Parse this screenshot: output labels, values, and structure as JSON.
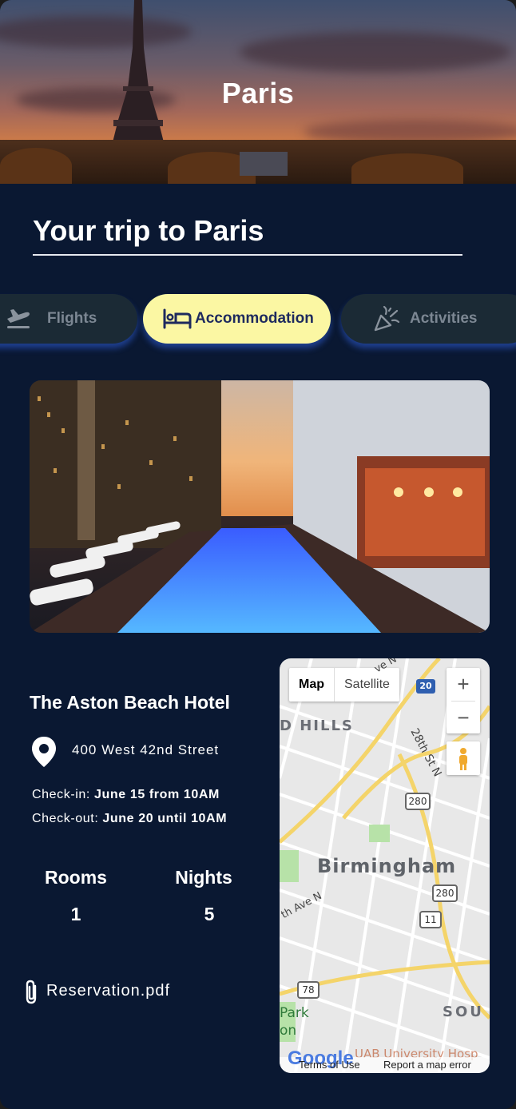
{
  "hero": {
    "city": "Paris"
  },
  "trip": {
    "title": "Your trip to Paris"
  },
  "tabs": [
    {
      "label": "Flights",
      "icon": "plane-departure-icon",
      "active": false
    },
    {
      "label": "Accommodation",
      "icon": "bed-icon",
      "active": true
    },
    {
      "label": "Activities",
      "icon": "party-popper-icon",
      "active": false
    }
  ],
  "hotel": {
    "name": "The Aston Beach Hotel",
    "address": "400 West 42nd Street",
    "checkin_label": "Check-in:",
    "checkin_value": "June 15 from 10AM",
    "checkout_label": "Check-out:",
    "checkout_value": "June 20 until 10AM",
    "rooms_label": "Rooms",
    "rooms_value": "1",
    "nights_label": "Nights",
    "nights_value": "5",
    "attachment": "Reservation.pdf"
  },
  "map": {
    "type_map": "Map",
    "type_satellite": "Satellite",
    "zoom_in": "+",
    "zoom_out": "−",
    "labels": {
      "hills": "D HILLS",
      "city": "Birmingham",
      "street_28": "28th St N",
      "street_ave": "th Ave N",
      "ave_top": "ve N",
      "south": "SOU",
      "park": "Park",
      "on": "on",
      "hospital": "UAB University Hosp"
    },
    "shields": [
      "20",
      "280",
      "280",
      "11",
      "78"
    ],
    "footer": {
      "google": "Google",
      "terms": "Terms of Use",
      "report": "Report a map error"
    }
  },
  "colors": {
    "background": "#0a1832",
    "active_tab": "#fbf7a3",
    "inactive_tab": "#1b2a35",
    "tab_glow": "#376eff"
  }
}
